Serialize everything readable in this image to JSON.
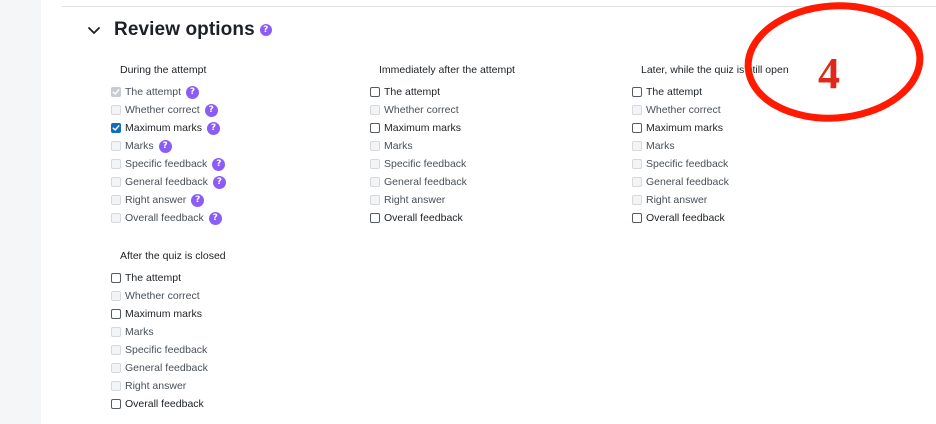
{
  "section": {
    "title": "Review options",
    "help": "?"
  },
  "annotation": {
    "label": "4",
    "color": "#ff1a00"
  },
  "colors": {
    "accent": "#0f6cbf",
    "help_badge": "#8b5cf6"
  },
  "groups": [
    {
      "title": "During the attempt",
      "options": [
        {
          "label": "The attempt",
          "checked": true,
          "disabled": true,
          "help": "?"
        },
        {
          "label": "Whether correct",
          "checked": false,
          "disabled": true,
          "help": "?"
        },
        {
          "label": "Maximum marks",
          "checked": true,
          "disabled": false,
          "help": "?"
        },
        {
          "label": "Marks",
          "checked": false,
          "disabled": true,
          "help": "?"
        },
        {
          "label": "Specific feedback",
          "checked": false,
          "disabled": true,
          "help": "?"
        },
        {
          "label": "General feedback",
          "checked": false,
          "disabled": true,
          "help": "?"
        },
        {
          "label": "Right answer",
          "checked": false,
          "disabled": true,
          "help": "?"
        },
        {
          "label": "Overall feedback",
          "checked": false,
          "disabled": true,
          "help": "?"
        }
      ]
    },
    {
      "title": "Immediately after the attempt",
      "options": [
        {
          "label": "The attempt",
          "checked": false,
          "disabled": false
        },
        {
          "label": "Whether correct",
          "checked": false,
          "disabled": true
        },
        {
          "label": "Maximum marks",
          "checked": false,
          "disabled": false
        },
        {
          "label": "Marks",
          "checked": false,
          "disabled": true
        },
        {
          "label": "Specific feedback",
          "checked": false,
          "disabled": true
        },
        {
          "label": "General feedback",
          "checked": false,
          "disabled": true
        },
        {
          "label": "Right answer",
          "checked": false,
          "disabled": true
        },
        {
          "label": "Overall feedback",
          "checked": false,
          "disabled": false
        }
      ]
    },
    {
      "title": "Later, while the quiz is still open",
      "options": [
        {
          "label": "The attempt",
          "checked": false,
          "disabled": false
        },
        {
          "label": "Whether correct",
          "checked": false,
          "disabled": true
        },
        {
          "label": "Maximum marks",
          "checked": false,
          "disabled": false
        },
        {
          "label": "Marks",
          "checked": false,
          "disabled": true
        },
        {
          "label": "Specific feedback",
          "checked": false,
          "disabled": true
        },
        {
          "label": "General feedback",
          "checked": false,
          "disabled": true
        },
        {
          "label": "Right answer",
          "checked": false,
          "disabled": true
        },
        {
          "label": "Overall feedback",
          "checked": false,
          "disabled": false
        }
      ]
    },
    {
      "title": "After the quiz is closed",
      "options": [
        {
          "label": "The attempt",
          "checked": false,
          "disabled": false
        },
        {
          "label": "Whether correct",
          "checked": false,
          "disabled": true
        },
        {
          "label": "Maximum marks",
          "checked": false,
          "disabled": false
        },
        {
          "label": "Marks",
          "checked": false,
          "disabled": true
        },
        {
          "label": "Specific feedback",
          "checked": false,
          "disabled": true
        },
        {
          "label": "General feedback",
          "checked": false,
          "disabled": true
        },
        {
          "label": "Right answer",
          "checked": false,
          "disabled": true
        },
        {
          "label": "Overall feedback",
          "checked": false,
          "disabled": false
        }
      ]
    }
  ]
}
